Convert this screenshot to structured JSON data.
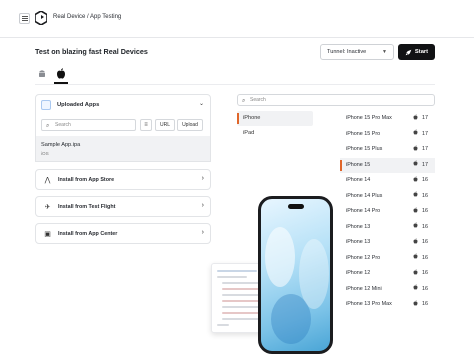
{
  "header": {
    "breadcrumb": "Real Device / App Testing"
  },
  "main": {
    "title": "Test on blazing fast Real Devices",
    "tunnel_label": "Tunnel: Inactive",
    "start_label": "Start",
    "os_tabs": [
      "android",
      "ios"
    ]
  },
  "apps_panel": {
    "title": "Uploaded Apps",
    "search_placeholder": "Search",
    "url_label": "URL",
    "upload_label": "Upload",
    "selected_app": {
      "name": "Sample App.ipa",
      "os": "iOS"
    }
  },
  "install_options": [
    {
      "label": "Install from App Store",
      "icon": "app-store-icon"
    },
    {
      "label": "Install from Test Flight",
      "icon": "test-flight-icon"
    },
    {
      "label": "Install from App Center",
      "icon": "app-center-icon"
    }
  ],
  "devices": {
    "search_placeholder": "Search",
    "brands": [
      "iPhone",
      "iPad"
    ],
    "selected_brand": "iPhone",
    "models": [
      {
        "name": "iPhone 15 Pro Max",
        "version": "17"
      },
      {
        "name": "iPhone 15 Pro",
        "version": "17"
      },
      {
        "name": "iPhone 15 Plus",
        "version": "17"
      },
      {
        "name": "iPhone 15",
        "version": "17"
      },
      {
        "name": "iPhone 14",
        "version": "16"
      },
      {
        "name": "iPhone 14 Plus",
        "version": "16"
      },
      {
        "name": "iPhone 14 Pro",
        "version": "16"
      },
      {
        "name": "iPhone 13",
        "version": "16"
      },
      {
        "name": "iPhone 13",
        "version": "16"
      },
      {
        "name": "iPhone 12 Pro",
        "version": "16"
      },
      {
        "name": "iPhone 12",
        "version": "16"
      },
      {
        "name": "iPhone 12 Mini",
        "version": "16"
      },
      {
        "name": "iPhone 13 Pro Max",
        "version": "16"
      }
    ],
    "selected_model": "iPhone 15"
  },
  "colors": {
    "accent": "#e0662a",
    "primary_button": "#111214",
    "selected_row": "#f1f2f4"
  }
}
